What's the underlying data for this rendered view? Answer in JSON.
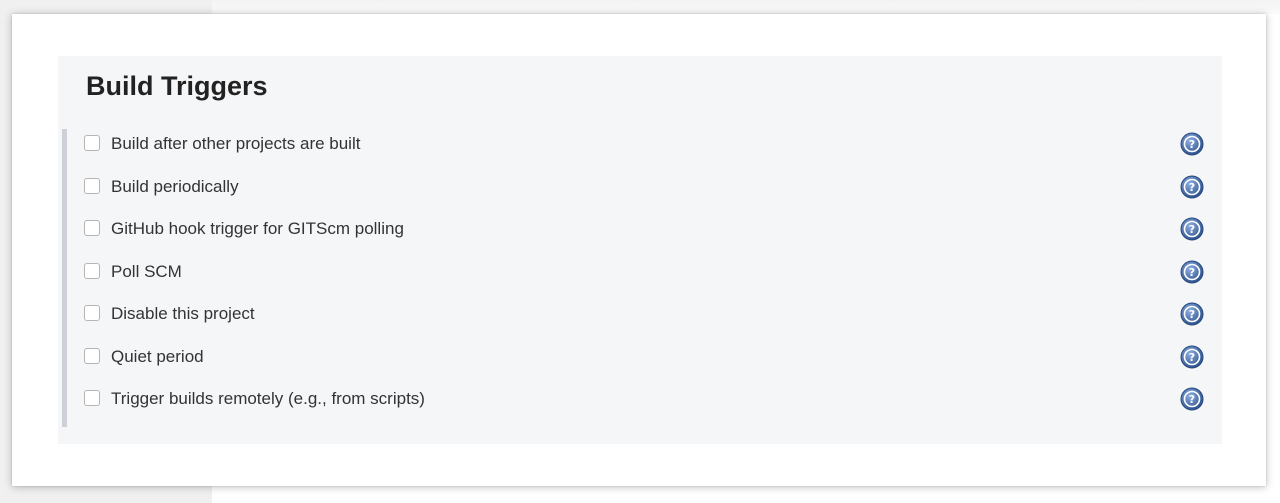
{
  "section": {
    "title": "Build Triggers"
  },
  "options": [
    {
      "label": "Build after other projects are built",
      "checked": false,
      "help_icon": "help-icon"
    },
    {
      "label": "Build periodically",
      "checked": false,
      "help_icon": "help-icon"
    },
    {
      "label": "GitHub hook trigger for GITScm polling",
      "checked": false,
      "help_icon": "help-icon"
    },
    {
      "label": "Poll SCM",
      "checked": false,
      "help_icon": "help-icon"
    },
    {
      "label": "Disable this project",
      "checked": false,
      "help_icon": "help-icon"
    },
    {
      "label": "Quiet period",
      "checked": false,
      "help_icon": "help-icon"
    },
    {
      "label": "Trigger builds remotely (e.g., from scripts)",
      "checked": false,
      "help_icon": "help-icon"
    }
  ],
  "colors": {
    "help_icon": "#4a6fa8",
    "section_background": "#f5f6f8",
    "group_border": "#cdd0d6"
  }
}
